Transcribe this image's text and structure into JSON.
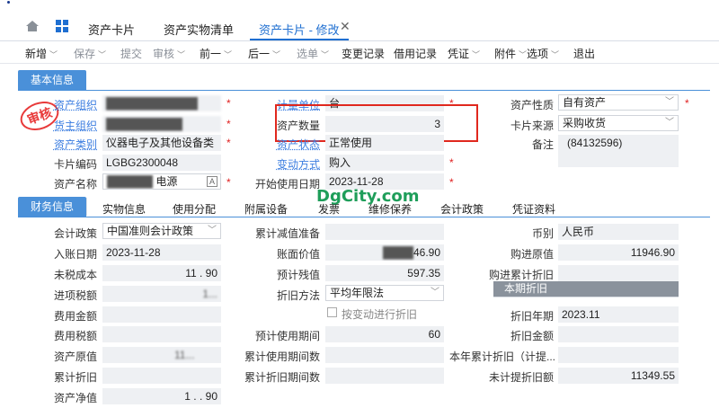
{
  "nav": {
    "tabs": [
      {
        "label": "资产卡片"
      },
      {
        "label": "资产实物清单"
      },
      {
        "label": "资产卡片 - 修改"
      }
    ]
  },
  "toolbar": {
    "items": [
      "新增",
      "保存",
      "提交",
      "审核",
      "前一",
      "后一",
      "选单",
      "变更记录",
      "借用记录",
      "凭证",
      "附件",
      "选项",
      "退出"
    ]
  },
  "basic": {
    "section_label": "基本信息",
    "asset_org_label": "资产组织",
    "owner_org_label": "货主组织",
    "asset_category_label": "资产类别",
    "asset_category_value": "仪器电子及其他设备类",
    "card_no_label": "卡片编码",
    "card_no_value": "LGBG2300048",
    "asset_name_label": "资产名称",
    "asset_name_value": "电源",
    "unit_label": "计量单位",
    "unit_value": "台",
    "qty_label": "资产数量",
    "qty_value": "3",
    "status_label": "资产状态",
    "status_value": "正常使用",
    "change_label": "变动方式",
    "change_value": "购入",
    "start_date_label": "开始使用日期",
    "start_date_value": "2023-11-28",
    "nature_label": "资产性质",
    "nature_value": "自有资产",
    "source_label": "卡片来源",
    "source_value": "采购收货",
    "remark_label": "备注",
    "remark_value": "(84132596)",
    "stamp": "审核"
  },
  "fin_tabs": [
    "财务信息",
    "实物信息",
    "使用分配",
    "附属设备",
    "发票",
    "维修保养",
    "会计政策",
    "凭证资料"
  ],
  "watermark": "DgCity.com",
  "finance": {
    "policy_label": "会计政策",
    "policy_value": "中国准则会计政策",
    "entry_date_label": "入账日期",
    "entry_date_value": "2023-11-28",
    "untaxed_label": "未税成本",
    "untaxed_value": "11 . 90",
    "tax_label": "进项税额",
    "tax_value": "1...",
    "fee_label": "费用金额",
    "fee_tax_label": "费用税额",
    "orig_label": "资产原值",
    "orig_value": "11...",
    "acc_dep_label": "累计折旧",
    "net_label": "资产净值",
    "net_value": "1 . . 90",
    "impair_label": "累计减值准备",
    "book_label": "账面价值",
    "book_value": "46.90",
    "residual_label": "预计残值",
    "residual_value": "597.35",
    "method_label": "折旧方法",
    "method_value": "平均年限法",
    "by_change_label": "按变动进行折旧",
    "life_label": "预计使用期间",
    "life_value": "60",
    "used_label": "累计使用期间数",
    "dep_periods_label": "累计折旧期间数",
    "currency_label": "币别",
    "currency_value": "人民币",
    "purchase_label": "购进原值",
    "purchase_value": "11946.90",
    "purchase_acc_label": "购进累计折旧",
    "this_period_label": "本期折旧",
    "dep_year_label": "折旧年期",
    "dep_year_value": "2023.11",
    "dep_amt_label": "折旧金额",
    "year_acc_label": "本年累计折旧（计提...",
    "undep_label": "未计提折旧额",
    "undep_value": "11349.55"
  },
  "colors": {
    "accent": "#1f6fd1",
    "section": "#4a90d9",
    "highlight": "#e0281e",
    "stamp": "#e83a3a"
  }
}
